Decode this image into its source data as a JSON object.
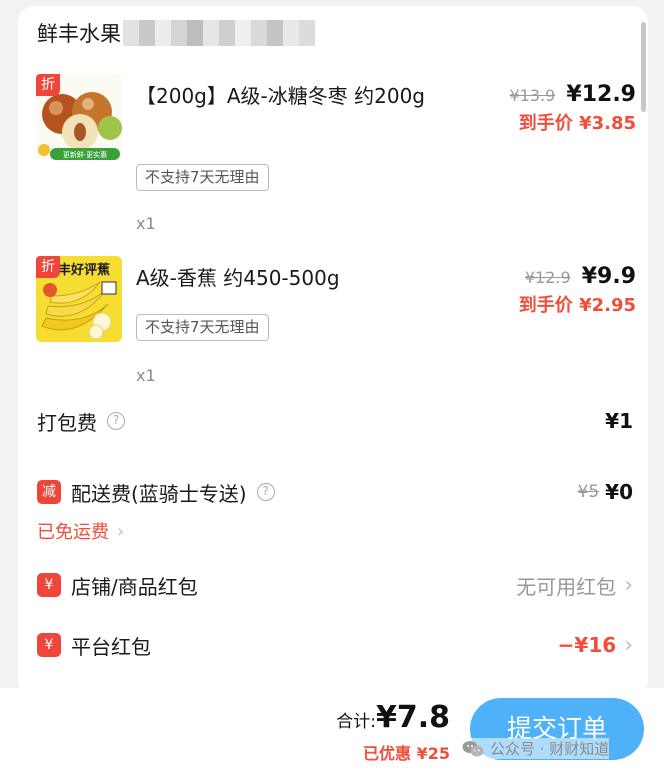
{
  "shop": {
    "name": "鲜丰水果"
  },
  "products": [
    {
      "badge": "折",
      "name": "【200g】A级-冰糖冬枣 约200g",
      "chip": "不支持7天无理由",
      "qty": "x1",
      "orig_price": "¥13.9",
      "price": "¥12.9",
      "deal": "到手价 ¥3.85",
      "image_text": "更新鲜·更实惠"
    },
    {
      "badge": "折",
      "name": "A级-香蕉 约450-500g",
      "chip": "不支持7天无理由",
      "qty": "x1",
      "orig_price": "¥12.9",
      "price": "¥9.9",
      "deal": "到手价 ¥2.95",
      "image_text": "丰好评蕉"
    }
  ],
  "fees": {
    "packing": {
      "label": "打包费",
      "value": "¥1"
    },
    "delivery": {
      "badge": "减",
      "label": "配送费(蓝骑士专送)",
      "orig": "¥5",
      "value": "¥0",
      "note": "已免运费"
    },
    "shop_coupon": {
      "badge": "¥",
      "label": "店铺/商品红包",
      "value": "无可用红包"
    },
    "platform_coupon": {
      "badge": "¥",
      "label": "平台红包",
      "value": "−¥16"
    }
  },
  "footer": {
    "total_label": "合计:",
    "total_value": "¥7.8",
    "saved": "已优惠 ¥25",
    "submit": "提交订单",
    "watermark": "公众号 · 财财知道"
  },
  "colors": {
    "accent_red": "#ef4e3a",
    "submit_blue": "#4fb1f8",
    "badge_red": "#f0453a"
  }
}
